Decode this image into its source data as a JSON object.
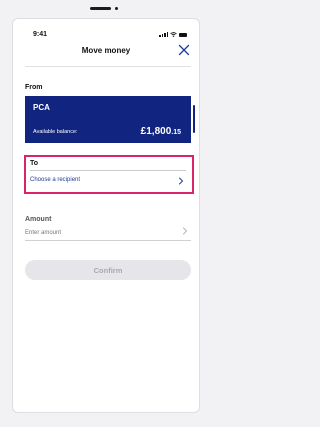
{
  "status_bar": {
    "time": "9:41",
    "icons": [
      "signal-icon",
      "wifi-icon",
      "battery-icon"
    ]
  },
  "header": {
    "title": "Move money",
    "close_icon": "close-icon"
  },
  "from": {
    "label": "From",
    "account": {
      "name": "PCA",
      "balance_label": "Available balance:",
      "balance_main": "£1,800",
      "balance_pence": ".15"
    }
  },
  "to": {
    "label": "To",
    "placeholder": "Choose a recipient"
  },
  "amount": {
    "label": "Amount",
    "placeholder": "Enter amount"
  },
  "actions": {
    "confirm_label": "Confirm"
  },
  "colors": {
    "brand_navy": "#11247f",
    "highlight_pink": "#d9236b",
    "link_blue": "#1f3c9b",
    "disabled_button": "#e6e6ea"
  }
}
